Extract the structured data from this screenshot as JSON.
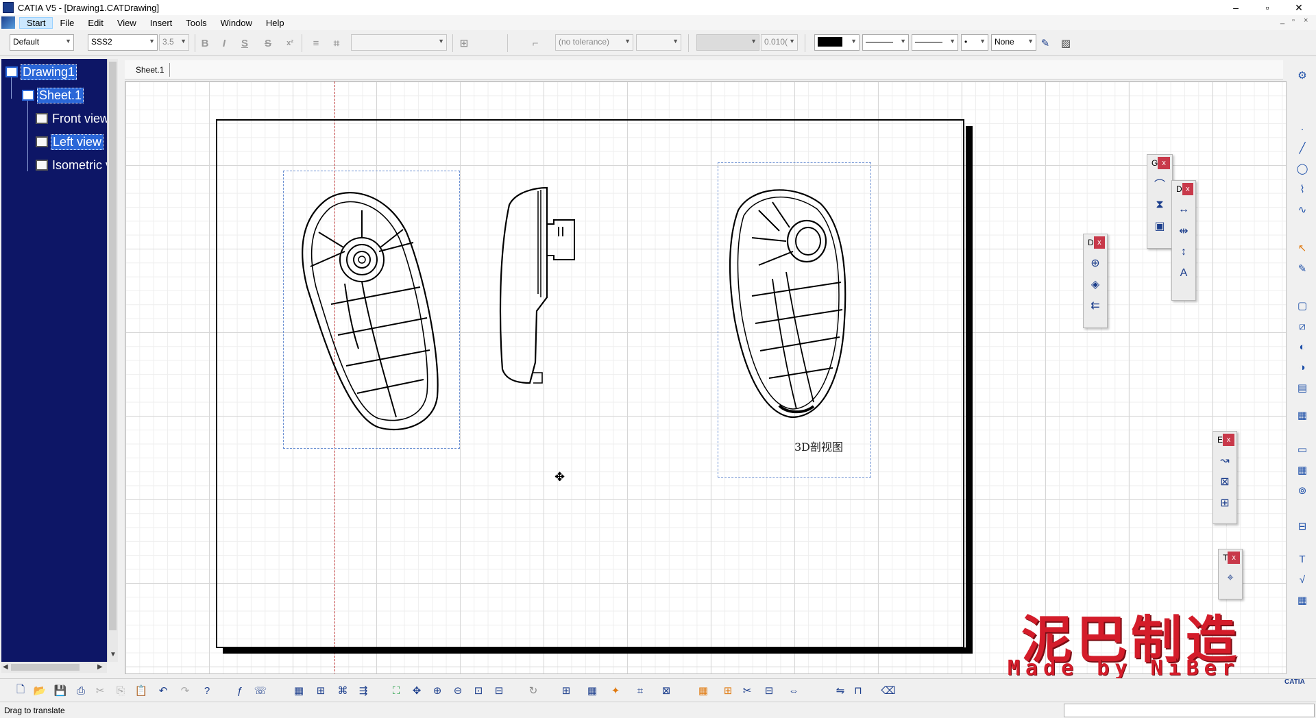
{
  "window": {
    "title": "CATIA V5 - [Drawing1.CATDrawing]",
    "minimize": "–",
    "maximize": "▫",
    "close": "✕",
    "mdi_min": "_",
    "mdi_max": "▫",
    "mdi_close": "×"
  },
  "menu": {
    "items": [
      "Start",
      "File",
      "Edit",
      "View",
      "Insert",
      "Tools",
      "Window",
      "Help"
    ]
  },
  "toolbar": {
    "style_value": "Default",
    "font_value": "SSS2",
    "size_value": "3.5",
    "bold": "B",
    "italic": "I",
    "underline": "S",
    "strike": "S",
    "superscript": "x²",
    "tolerance_value": "(no tolerance)",
    "precision_value": "0.010(",
    "linetype_value": "None"
  },
  "tree": {
    "root": "Drawing1",
    "sheet": "Sheet.1",
    "views": [
      "Front view",
      "Left view",
      "Isometric view"
    ]
  },
  "tab": {
    "label": "Sheet.1"
  },
  "drawing": {
    "caption": "3D剖视图"
  },
  "floating_toolbars": {
    "g_label": "G",
    "d1_label": "D",
    "d2_label": "D",
    "e_label": "E",
    "t_label": "T",
    "close_glyph": "x"
  },
  "status": {
    "text": "Drag to translate"
  },
  "watermark": {
    "cn": "泥巴制造",
    "en": "Made by NiBer"
  },
  "brand": {
    "logo_text": "CATIA"
  },
  "colors": {
    "tree_bg": "#0d1666",
    "selection": "#2a67d8",
    "watermark": "#d41c2a",
    "view_frame": "#6a8fd2"
  }
}
